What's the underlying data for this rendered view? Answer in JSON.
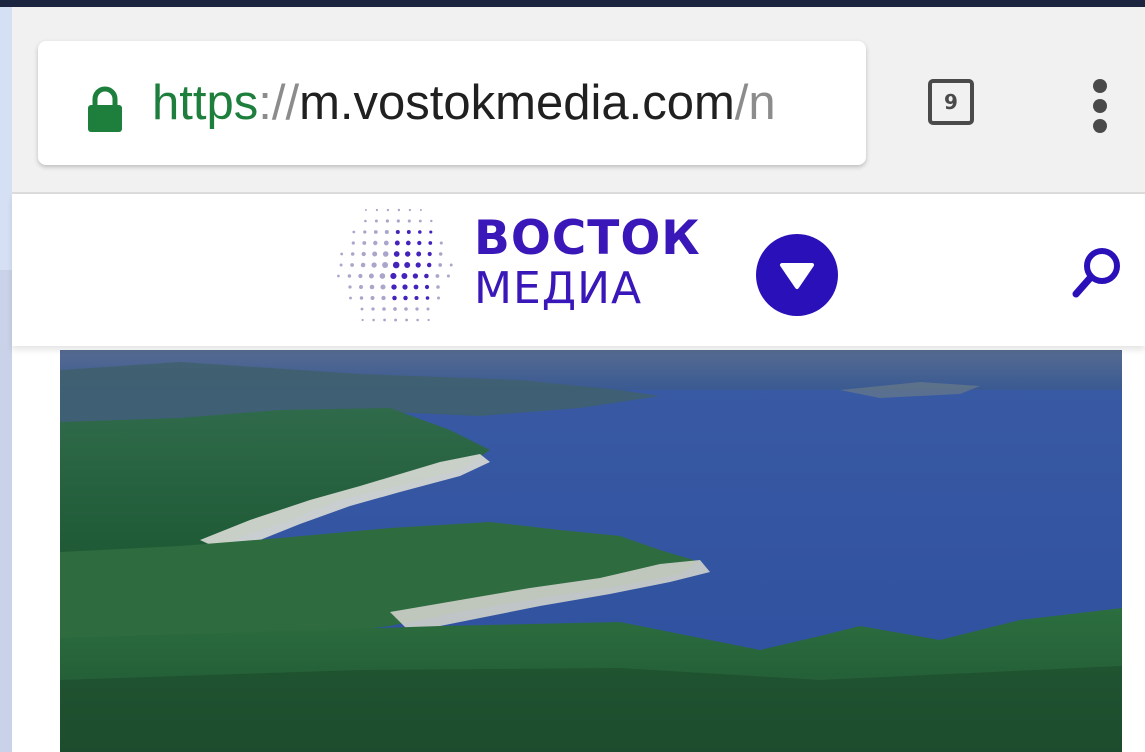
{
  "browser": {
    "url_scheme": "https",
    "url_separator": "://",
    "url_host": "m.vostokmedia.com",
    "url_path": "/n",
    "tab_count": "9",
    "icons": {
      "lock": "lock-icon",
      "tabs": "tab-counter-icon",
      "menu": "overflow-menu-icon"
    },
    "colors": {
      "secure": "#1e7f3c",
      "toolbar": "#f1f1f1"
    }
  },
  "site": {
    "logo": {
      "line1": "ВОСТОК",
      "line2": "МЕДИА"
    },
    "icons": {
      "dropdown": "chevron-down-icon",
      "search": "search-icon"
    },
    "colors": {
      "brand": "#3a17b8"
    }
  }
}
